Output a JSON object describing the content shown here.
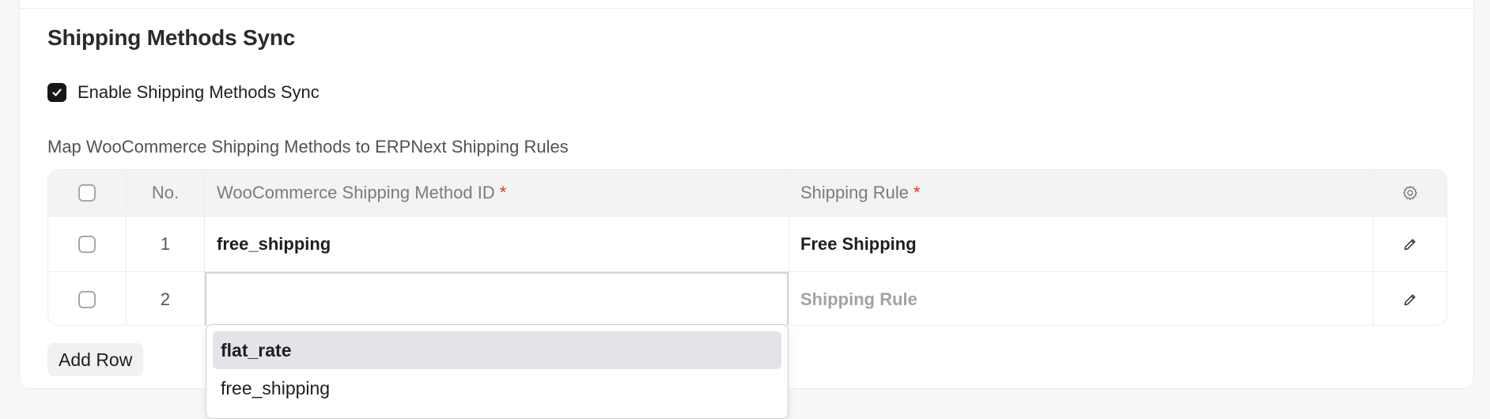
{
  "section": {
    "title": "Shipping Methods Sync",
    "enable_checkbox": {
      "label": "Enable Shipping Methods Sync",
      "checked": true
    },
    "table_caption": "Map WooCommerce Shipping Methods to ERPNext Shipping Rules"
  },
  "table": {
    "columns": {
      "no": "No.",
      "method": "WooCommerce Shipping Method ID",
      "rule": "Shipping Rule",
      "required_mark": "*"
    },
    "rows": [
      {
        "no": "1",
        "method": "free_shipping",
        "rule": "Free Shipping"
      },
      {
        "no": "2",
        "method": "",
        "rule_placeholder": "Shipping Rule"
      }
    ]
  },
  "dropdown": {
    "options": [
      "flat_rate",
      "free_shipping"
    ],
    "highlighted": "flat_rate"
  },
  "add_row_label": "Add Row",
  "icons": {
    "settings": "gear-icon",
    "edit": "pencil-icon",
    "check": "checkmark-icon"
  },
  "colors": {
    "required": "#e03636",
    "checkbox_fill": "#171717",
    "highlight": "#e3e3e8"
  }
}
